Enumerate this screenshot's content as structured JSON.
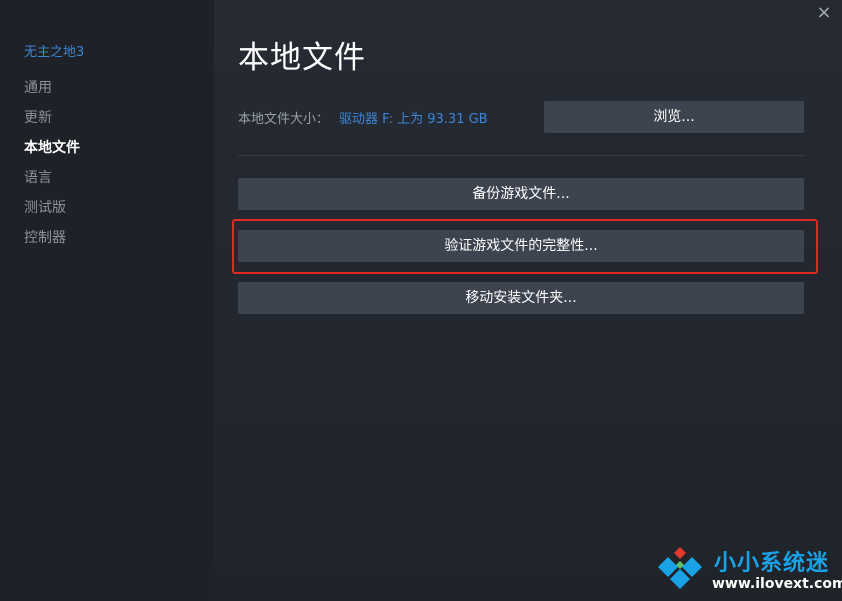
{
  "sidebar": {
    "game_title": "无主之地3",
    "items": [
      {
        "label": "通用",
        "active": false
      },
      {
        "label": "更新",
        "active": false
      },
      {
        "label": "本地文件",
        "active": true
      },
      {
        "label": "语言",
        "active": false
      },
      {
        "label": "测试版",
        "active": false
      },
      {
        "label": "控制器",
        "active": false
      }
    ]
  },
  "window": {
    "close_icon": "×"
  },
  "main": {
    "title": "本地文件",
    "size_label": "本地文件大小：",
    "size_value": "驱动器 F: 上为 93.31 GB",
    "browse_label": "浏览...",
    "backup_label": "备份游戏文件...",
    "verify_label": "验证游戏文件的完整性...",
    "move_label": "移动安装文件夹..."
  },
  "watermark": {
    "name": "小小系统迷",
    "url": "www.ilovext.com"
  },
  "colors": {
    "accent_link": "#3b86d6",
    "highlight": "#e02a1f",
    "button_bg": "#3d4450",
    "watermark_blue": "#19a3e6"
  }
}
